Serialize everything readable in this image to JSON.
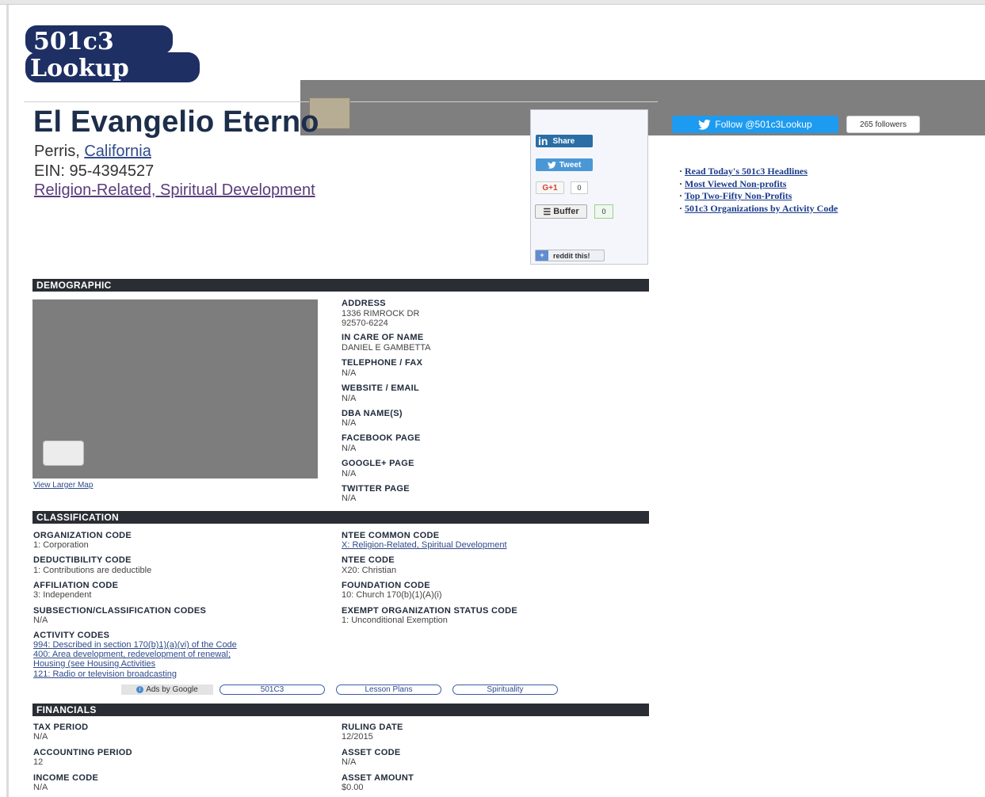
{
  "logo": {
    "line1": "501c3",
    "line2": "Lookup"
  },
  "org": {
    "name": "El Evangelio Eterno",
    "city": "Perris,",
    "state": "California",
    "ein": "EIN: 95-4394527",
    "category": "Religion-Related, Spiritual Development"
  },
  "share": {
    "linkedin": "Share",
    "tweet": "Tweet",
    "gplus": "G+1",
    "gplus_count": "0",
    "buffer": "Buffer",
    "buffer_count": "0",
    "reddit": "reddit this!"
  },
  "twitter": {
    "follow": "Follow @501c3Lookup",
    "followers": "265 followers"
  },
  "side_links": [
    "Read Today's 501c3 Headlines",
    "Most Viewed Non-profits",
    "Top Two-Fifty Non-Profits",
    "501c3 Organizations by Activity Code"
  ],
  "sections": {
    "demographic": "DEMOGRAPHIC",
    "classification": "CLASSIFICATION",
    "financials": "FINANCIALS"
  },
  "map": {
    "link": "View Larger Map"
  },
  "demographic": [
    {
      "label": "ADDRESS",
      "values": [
        "1336 RIMROCK DR",
        "92570-6224"
      ]
    },
    {
      "label": "IN CARE OF NAME",
      "values": [
        "DANIEL E GAMBETTA"
      ]
    },
    {
      "label": "TELEPHONE / FAX",
      "values": [
        "N/A"
      ]
    },
    {
      "label": "WEBSITE / EMAIL",
      "values": [
        "N/A"
      ]
    },
    {
      "label": "DBA NAME(S)",
      "values": [
        "N/A"
      ]
    },
    {
      "label": "FACEBOOK PAGE",
      "values": [
        "N/A"
      ]
    },
    {
      "label": "GOOGLE+ PAGE",
      "values": [
        "N/A"
      ]
    },
    {
      "label": "TWITTER PAGE",
      "values": [
        "N/A"
      ]
    }
  ],
  "classification": {
    "left": [
      {
        "label": "ORGANIZATION CODE",
        "value": "1: Corporation"
      },
      {
        "label": "DEDUCTIBILITY CODE",
        "value": "1: Contributions are deductible"
      },
      {
        "label": "AFFILIATION CODE",
        "value": "3: Independent"
      },
      {
        "label": "SUBSECTION/CLASSIFICATION CODES",
        "value": "N/A"
      }
    ],
    "right": [
      {
        "label": "NTEE COMMON CODE",
        "value": "X: Religion-Related, Spiritual Development"
      },
      {
        "label": "NTEE CODE",
        "value": "X20: Christian"
      },
      {
        "label": "FOUNDATION CODE",
        "value": "10: Church 170(b)(1)(A)(i)"
      },
      {
        "label": "EXEMPT ORGANIZATION STATUS CODE",
        "value": "1: Unconditional Exemption"
      }
    ],
    "activity_label": "ACTIVITY CODES",
    "activity": [
      "994: Described in section 170(b)1)(a)(vi) of the Code",
      "400: Area development, redevelopment of renewal;",
      "Housing (see Housing Activities",
      "121: Radio or television broadcasting"
    ]
  },
  "ads": {
    "label": "Ads by Google",
    "items": [
      "501C3",
      "Lesson Plans",
      "Spirituality"
    ]
  },
  "financials": {
    "left": [
      {
        "label": "TAX PERIOD",
        "value": "N/A"
      },
      {
        "label": "ACCOUNTING PERIOD",
        "value": "12"
      },
      {
        "label": "INCOME CODE",
        "value": "N/A"
      }
    ],
    "right": [
      {
        "label": "RULING DATE",
        "value": "12/2015"
      },
      {
        "label": "ASSET CODE",
        "value": "N/A"
      },
      {
        "label": "ASSET AMOUNT",
        "value": "$0.00"
      }
    ]
  }
}
